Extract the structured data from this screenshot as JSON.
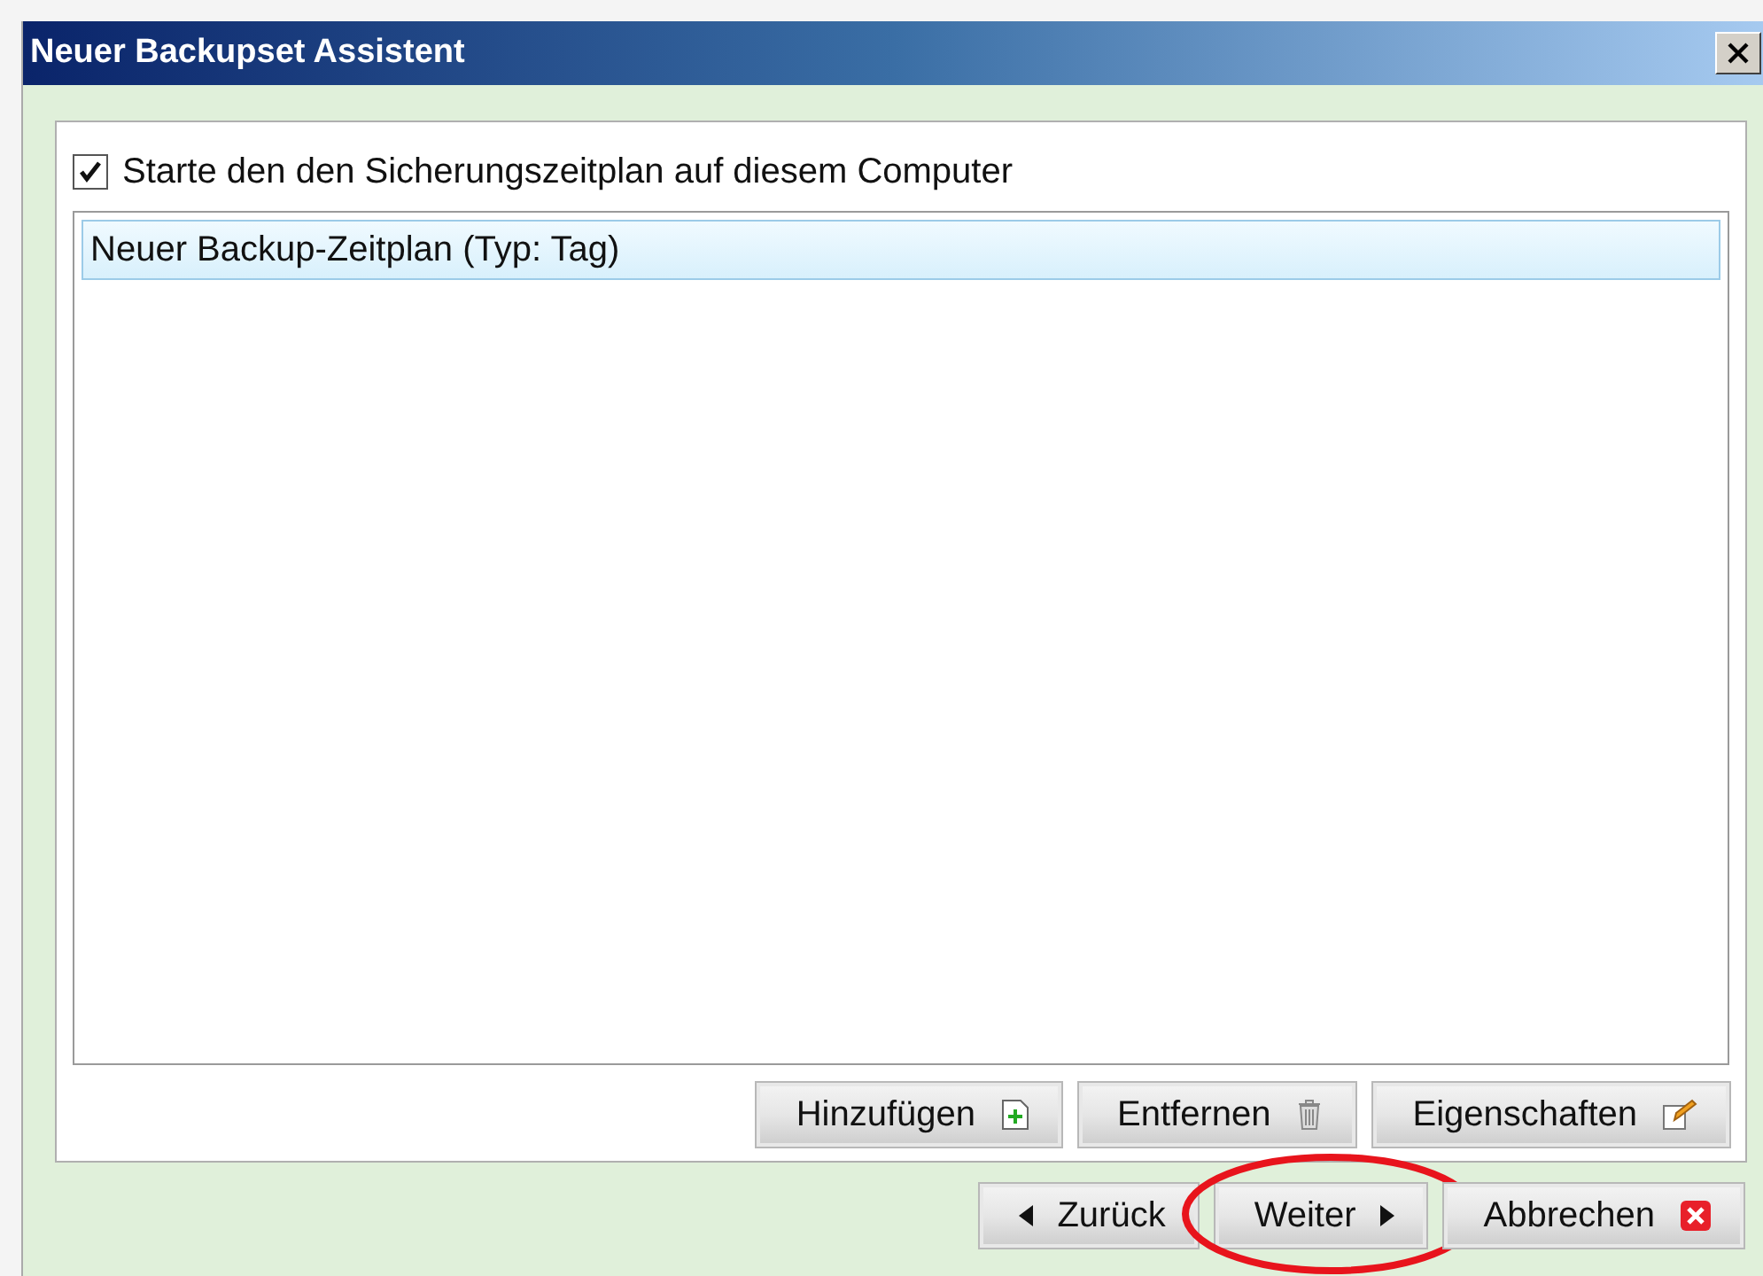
{
  "window": {
    "title": "Neuer Backupset Assistent"
  },
  "start_schedule": {
    "label": "Starte den den Sicherungszeitplan auf diesem Computer",
    "checked": true
  },
  "schedules": [
    {
      "label": "Neuer Backup-Zeitplan (Typ: Tag)",
      "selected": true
    }
  ],
  "list_buttons": [
    {
      "label": "Hinzufügen",
      "kind": "add"
    },
    {
      "label": "Entfernen",
      "kind": "remove"
    },
    {
      "label": "Eigenschaften",
      "kind": "edit"
    }
  ],
  "nav_buttons": [
    {
      "label": "Zurück",
      "kind": "back",
      "circled": false
    },
    {
      "label": "Weiter",
      "kind": "next",
      "circled": true
    },
    {
      "label": "Abbrechen",
      "kind": "cancel",
      "circled": false
    }
  ]
}
